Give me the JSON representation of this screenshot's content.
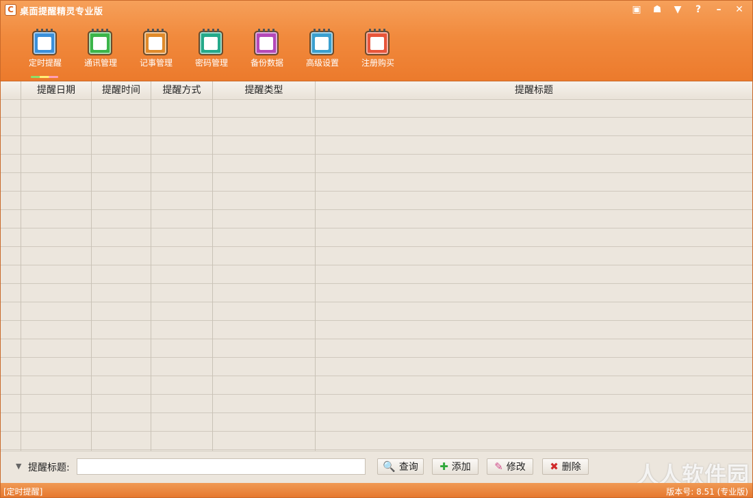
{
  "window": {
    "title": "桌面提醒精灵专业版",
    "title_icon": "app-logo-icon"
  },
  "window_controls": [
    {
      "name": "calendar-icon",
      "glyph": "▣"
    },
    {
      "name": "skin-icon",
      "glyph": "☗"
    },
    {
      "name": "menu-dropdown-icon",
      "glyph": "▼"
    },
    {
      "name": "help-icon",
      "glyph": "?"
    },
    {
      "name": "minimize-icon",
      "glyph": "–"
    },
    {
      "name": "close-icon",
      "glyph": "✕"
    }
  ],
  "toolbar": {
    "items": [
      {
        "label": "定时提醒",
        "icon": "clock-calendar-icon",
        "color": "#3a8fd9",
        "active": true
      },
      {
        "label": "通讯管理",
        "icon": "contacts-icon",
        "color": "#3bb54a"
      },
      {
        "label": "记事管理",
        "icon": "notes-pencil-icon",
        "color": "#e08a2a"
      },
      {
        "label": "密码管理",
        "icon": "password-key-icon",
        "color": "#24a98a"
      },
      {
        "label": "备份数据",
        "icon": "backup-disk-icon",
        "color": "#b449b8"
      },
      {
        "label": "高级设置",
        "icon": "settings-gear-icon",
        "color": "#3a9fcf"
      },
      {
        "label": "注册购买",
        "icon": "register-cart-icon",
        "color": "#e8553a"
      }
    ]
  },
  "table": {
    "columns": [
      "提醒日期",
      "提醒时间",
      "提醒方式",
      "提醒类型",
      "提醒标题"
    ],
    "rows": []
  },
  "search": {
    "label": "提醒标题:",
    "value": "",
    "buttons": [
      {
        "label": "查询",
        "icon": "search-icon",
        "glyph": "🔍",
        "color": "#2f6fd0"
      },
      {
        "label": "添加",
        "icon": "add-icon",
        "glyph": "✚",
        "color": "#2fa83a"
      },
      {
        "label": "修改",
        "icon": "edit-pencil-icon",
        "glyph": "✎",
        "color": "#d04a8a"
      },
      {
        "label": "删除",
        "icon": "delete-icon",
        "glyph": "✖",
        "color": "#d02a2a"
      }
    ]
  },
  "status": {
    "left": "[定时提醒]",
    "right": "版本号: 8.51 (专业版)"
  },
  "watermark": "人人软件园"
}
